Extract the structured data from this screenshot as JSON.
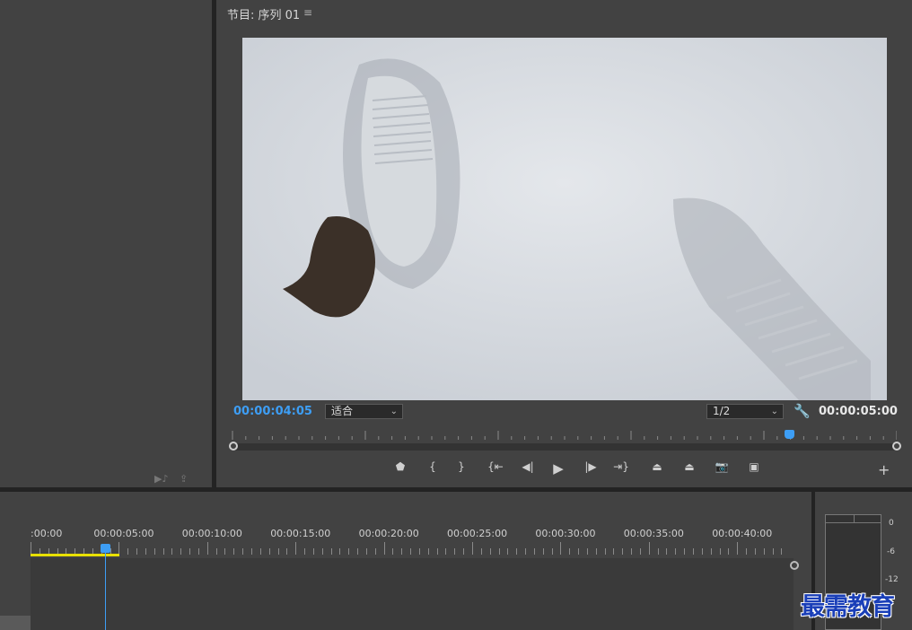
{
  "program_monitor": {
    "title": "节目: 序列 01",
    "menu_icon": "≡",
    "current_timecode": "00:00:04:05",
    "total_timecode": "00:00:05:00",
    "zoom_select": "适合",
    "resolution_select": "1/2",
    "playhead_fraction": 0.85
  },
  "controls": [
    {
      "name": "add-marker-button",
      "glyph": "⬟"
    },
    {
      "name": "mark-in-button",
      "glyph": "{"
    },
    {
      "name": "mark-out-button",
      "glyph": "}"
    },
    {
      "name": "go-to-in-button",
      "glyph": "{⇤"
    },
    {
      "name": "step-back-button",
      "glyph": "◀|"
    },
    {
      "name": "play-button",
      "glyph": "▶"
    },
    {
      "name": "step-forward-button",
      "glyph": "|▶"
    },
    {
      "name": "go-to-out-button",
      "glyph": "⇥}"
    },
    {
      "name": "lift-button",
      "glyph": "⏏"
    },
    {
      "name": "extract-button",
      "glyph": "⏏"
    },
    {
      "name": "export-frame-button",
      "glyph": "📷"
    },
    {
      "name": "compare-view-button",
      "glyph": "▣"
    }
  ],
  "timeline": {
    "labels": [
      ":00:00",
      "00:00:05:00",
      "00:00:10:00",
      "00:00:15:00",
      "00:00:20:00",
      "00:00:25:00",
      "00:00:30:00",
      "00:00:35:00",
      "00:00:40:00"
    ]
  },
  "meter": {
    "labels": [
      "0",
      "-6",
      "-12"
    ]
  },
  "watermark": "最需教育",
  "colors": {
    "accent": "#3d9ef5",
    "work_area": "#e8e000",
    "watermark": "#1a3fb8"
  }
}
